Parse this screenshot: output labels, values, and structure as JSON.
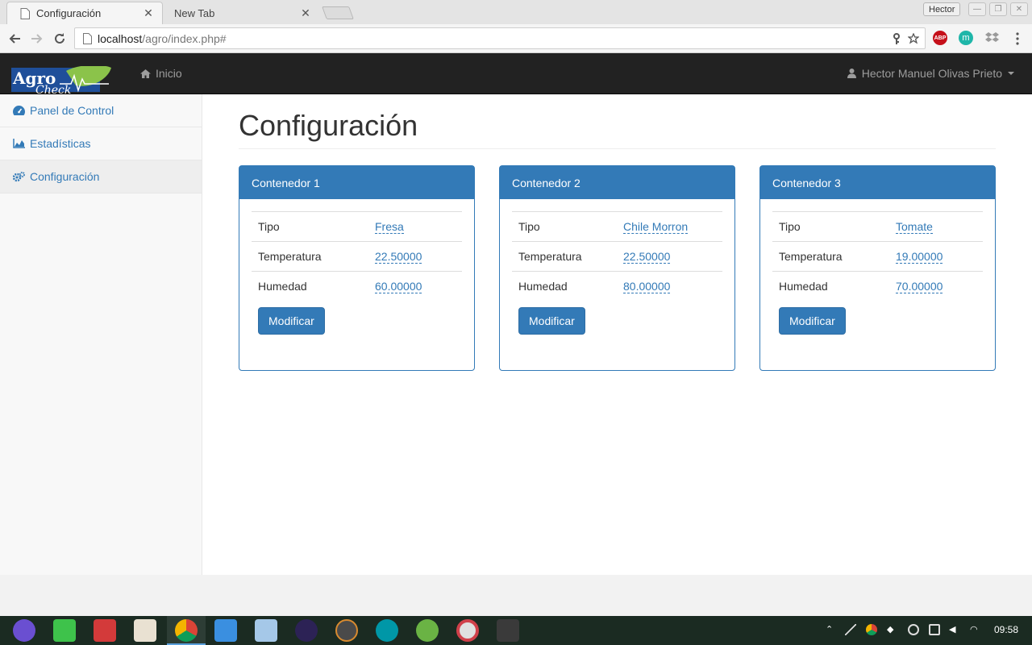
{
  "browser": {
    "tabs": [
      {
        "title": "Configuración",
        "active": true
      },
      {
        "title": "New Tab",
        "active": false
      }
    ],
    "window_user": "Hector",
    "url_host": "localhost",
    "url_path": "/agro/index.php#",
    "extensions": [
      "ABP",
      "m"
    ]
  },
  "navbar": {
    "brand_top": "Agro",
    "brand_bottom": "Check",
    "home_label": "Inicio",
    "user_name": "Hector Manuel Olivas Prieto"
  },
  "sidebar": {
    "items": [
      {
        "label": "Panel de Control",
        "icon": "dashboard-icon"
      },
      {
        "label": "Estadísticas",
        "icon": "area-chart-icon"
      },
      {
        "label": "Configuración",
        "icon": "cogs-icon"
      }
    ]
  },
  "main": {
    "title": "Configuración",
    "panels": [
      {
        "heading": "Contenedor 1",
        "rows": [
          {
            "label": "Tipo",
            "value": "Fresa"
          },
          {
            "label": "Temperatura",
            "value": "22.50000"
          },
          {
            "label": "Humedad",
            "value": "60.00000"
          }
        ],
        "button": "Modificar"
      },
      {
        "heading": "Contenedor 2",
        "rows": [
          {
            "label": "Tipo",
            "value": "Chile Morron"
          },
          {
            "label": "Temperatura",
            "value": "22.50000"
          },
          {
            "label": "Humedad",
            "value": "80.00000"
          }
        ],
        "button": "Modificar"
      },
      {
        "heading": "Contenedor 3",
        "rows": [
          {
            "label": "Tipo",
            "value": "Tomate"
          },
          {
            "label": "Temperatura",
            "value": "19.00000"
          },
          {
            "label": "Humedad",
            "value": "70.00000"
          }
        ],
        "button": "Modificar"
      }
    ]
  },
  "taskbar": {
    "clock": "09:58"
  },
  "colors": {
    "primary": "#337ab7",
    "navbar": "#222222",
    "navbar_text": "#9d9d9d"
  }
}
